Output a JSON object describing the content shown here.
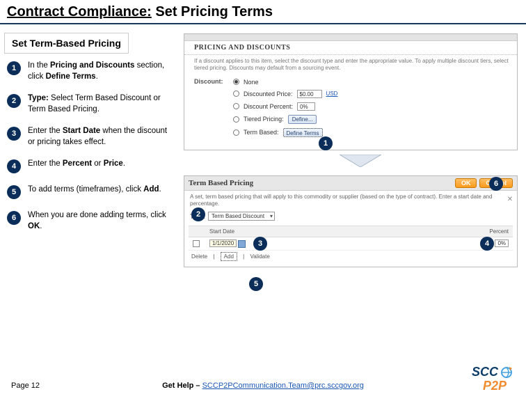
{
  "title": {
    "underlined": "Contract Compliance:",
    "rest": " Set Pricing Terms"
  },
  "subheading": "Set Term-Based Pricing",
  "steps": [
    {
      "num": "1",
      "pre": "In the ",
      "bold": "Pricing and Discounts",
      "mid": " section, click ",
      "bold2": "Define Terms",
      "post": "."
    },
    {
      "num": "2",
      "pre": "",
      "bold": "Type:",
      "mid": " Select Term Based Discount or Term Based Pricing.",
      "bold2": "",
      "post": ""
    },
    {
      "num": "3",
      "pre": "Enter the ",
      "bold": "Start Date",
      "mid": " when the discount or pricing takes effect.",
      "bold2": "",
      "post": ""
    },
    {
      "num": "4",
      "pre": "Enter the ",
      "bold": "Percent",
      "mid": " or ",
      "bold2": "Price",
      "post": "."
    },
    {
      "num": "5",
      "pre": "To add terms (timeframes), click ",
      "bold": "Add",
      "mid": ".",
      "bold2": "",
      "post": ""
    },
    {
      "num": "6",
      "pre": "When you are done adding terms, click ",
      "bold": "OK",
      "mid": ".",
      "bold2": "",
      "post": ""
    }
  ],
  "shot_top": {
    "section": "PRICING AND DISCOUNTS",
    "blurb": "If a discount applies to this item, select the discount type and enter the appropriate value. To apply multiple discount tiers, select tiered pricing. Discounts may default from a sourcing event.",
    "discount_label": "Discount:",
    "none": "None",
    "disc_price": "Discounted Price:",
    "disc_price_val": "$0.00",
    "usd": "USD",
    "disc_pct": "Discount Percent:",
    "disc_pct_val": "0%",
    "tiered": "Tiered Pricing:",
    "define": "Define...",
    "term_based": "Term Based:",
    "define_terms": "Define Terms"
  },
  "shot_bot": {
    "title": "Term Based Pricing",
    "ok": "OK",
    "cancel": "Cancel",
    "desc": "A set, term based pricing that will apply to this commodity or supplier (based on the type of contract). Enter a start date and percentage.",
    "type_label": "Type:",
    "type_value": "Term Based Discount",
    "col_start": "Start Date",
    "col_pct": "Percent",
    "date_val": "1/1/2020",
    "pct_val": "0%",
    "delete": "Delete",
    "add": "Add",
    "validate": "Validate"
  },
  "footer": {
    "page": "Page 12",
    "help_label": "Get Help – ",
    "help_link": "SCCP2PCommunication.Team@prc.sccgov.org"
  },
  "logo": {
    "top": "SCC",
    "bot": "P2P"
  }
}
